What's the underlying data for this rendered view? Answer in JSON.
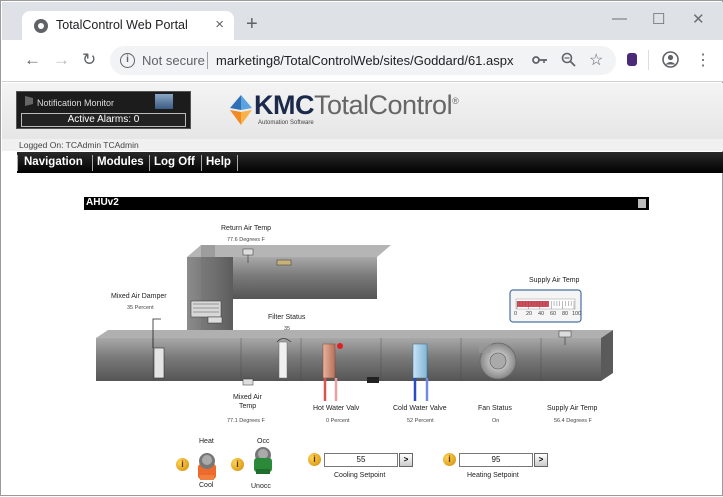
{
  "browser": {
    "tab_title": "TotalControl Web Portal",
    "tab_close": "×",
    "new_tab": "+",
    "not_secure": "Not secure",
    "url": "marketing8/TotalControlWeb/sites/Goddard/61.aspx",
    "back": "←",
    "forward": "→",
    "reload": "↻",
    "minimize": "—",
    "maximize": "☐",
    "close": "✕",
    "menu": "⋮"
  },
  "header": {
    "notification_label": "Notification Monitor",
    "active_alarms": "Active Alarms: 0",
    "logo_bold": "KMC",
    "logo_light": "TotalControl",
    "logo_reg": "®",
    "logo_sub": "Automation Software",
    "logged_on": "Logged On: TCAdmin TCAdmin"
  },
  "nav": {
    "items": [
      "Navigation",
      "Modules",
      "Log Off",
      "Help"
    ]
  },
  "panel": {
    "title": "AHUv2"
  },
  "diagram": {
    "return_air_temp": {
      "label": "Return Air Temp",
      "value": "77.6 Degrees F"
    },
    "mixed_air_damper": {
      "label": "Mixed Air Damper",
      "value": "35 Percent"
    },
    "filter_status": {
      "label": "Filter Status",
      "value": "35"
    },
    "supply_air_temp_gauge": {
      "label": "Supply Air Temp",
      "ticks": [
        "0",
        "20",
        "40",
        "60",
        "80",
        "100"
      ],
      "level": 0.56
    },
    "mixed_air_temp": {
      "label_line1": "Mixed Air",
      "label_line2": "Temp",
      "value": "77.1 Degrees F"
    },
    "hot_water_valve": {
      "label": "Hot Water Valv",
      "value": "0 Percent"
    },
    "cold_water_valve": {
      "label": "Cold Water Valve",
      "value": "52 Percent"
    },
    "fan_status": {
      "label": "Fan Status",
      "value": "On"
    },
    "supply_air_temp": {
      "label": "Supply Air Temp",
      "value": "56.4 Degrees F"
    }
  },
  "controls": {
    "heat_label": "Heat",
    "cool_label": "Cool",
    "occ_label": "Occ",
    "unocc_label": "Unocc",
    "info_glyph": "i",
    "cooling_setpoint": {
      "value": "55",
      "label": "Cooling Setpoint",
      "go": ">"
    },
    "heating_setpoint": {
      "value": "95",
      "label": "Heating Setpoint",
      "go": ">"
    }
  },
  "colors": {
    "duct": "#7d7d7d",
    "hot_water": "#d9534f",
    "cold_water": "#3a5bd0",
    "info": "#f2a900"
  }
}
